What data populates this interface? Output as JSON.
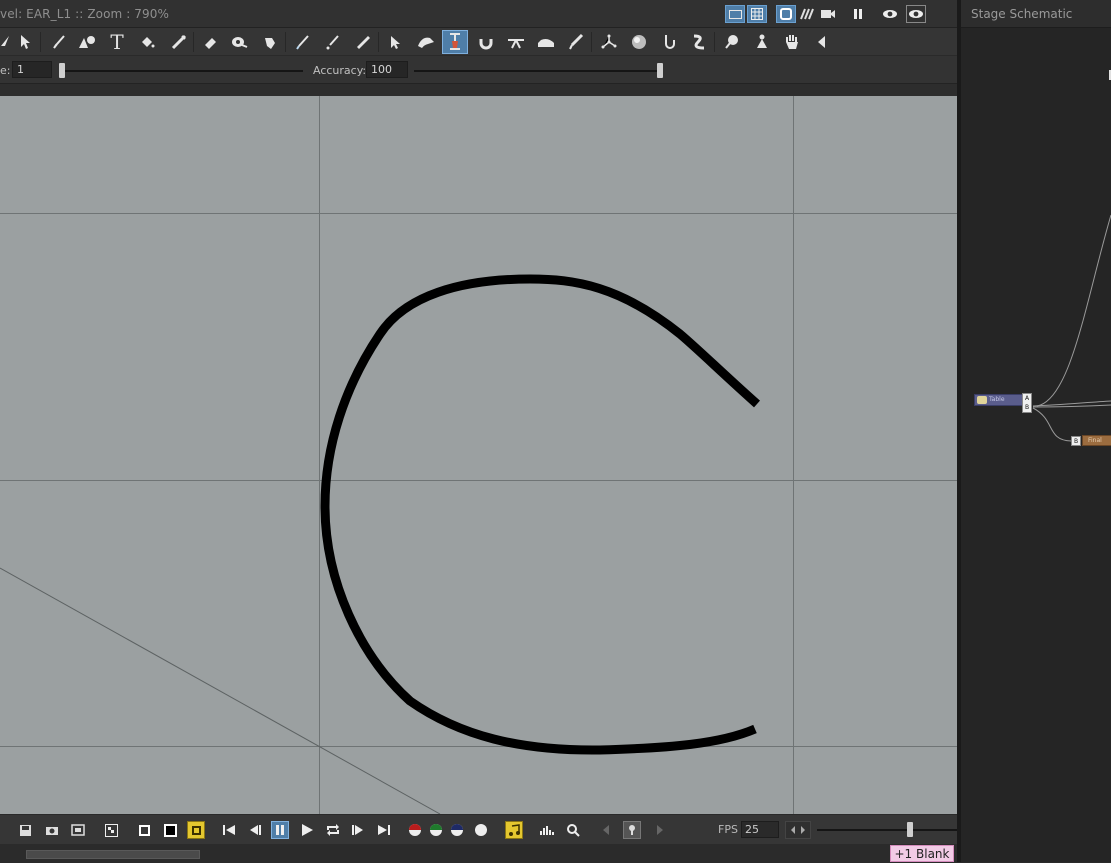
{
  "viewer": {
    "title": "vel: EAR_L1  ::  Zoom : 790%"
  },
  "tool_options": {
    "size_label": "e:",
    "size_value": "1",
    "accuracy_label": "Accuracy:",
    "accuracy_value": "100"
  },
  "tools": [
    "arrow-icon",
    "selection-icon",
    "brush-icon",
    "geometric-icon",
    "type-icon",
    "fill-icon",
    "paint-brush-icon",
    "eraser-icon",
    "tape-icon",
    "style-picker-icon",
    "rgb-picker-icon",
    "control-point-editor-icon",
    "pinch-icon",
    "pump-icon",
    "magnet-icon",
    "bender-icon",
    "iron-icon",
    "cutter-icon",
    "skeleton-icon",
    "tracker-icon",
    "hook-icon",
    "plastic-icon",
    "zoom-icon",
    "rotate-icon",
    "hand-icon",
    "collapse-icon"
  ],
  "active_tool": "pump-icon",
  "playback": {
    "fps_label": "FPS",
    "fps_value": "25"
  },
  "status": {
    "blank_badge": "+1 Blank"
  },
  "schematic": {
    "title": "Stage Schematic",
    "node_table_label": "Table",
    "node_a": "A",
    "node_b": "B",
    "node_b2": "B",
    "node_output_label": "Final"
  },
  "colors": {
    "canvas": "#9ba0a1",
    "accent_active": "#4f7ea8",
    "highlight_yellow": "#e4c72f",
    "badge_pink": "#f2cbe6"
  }
}
